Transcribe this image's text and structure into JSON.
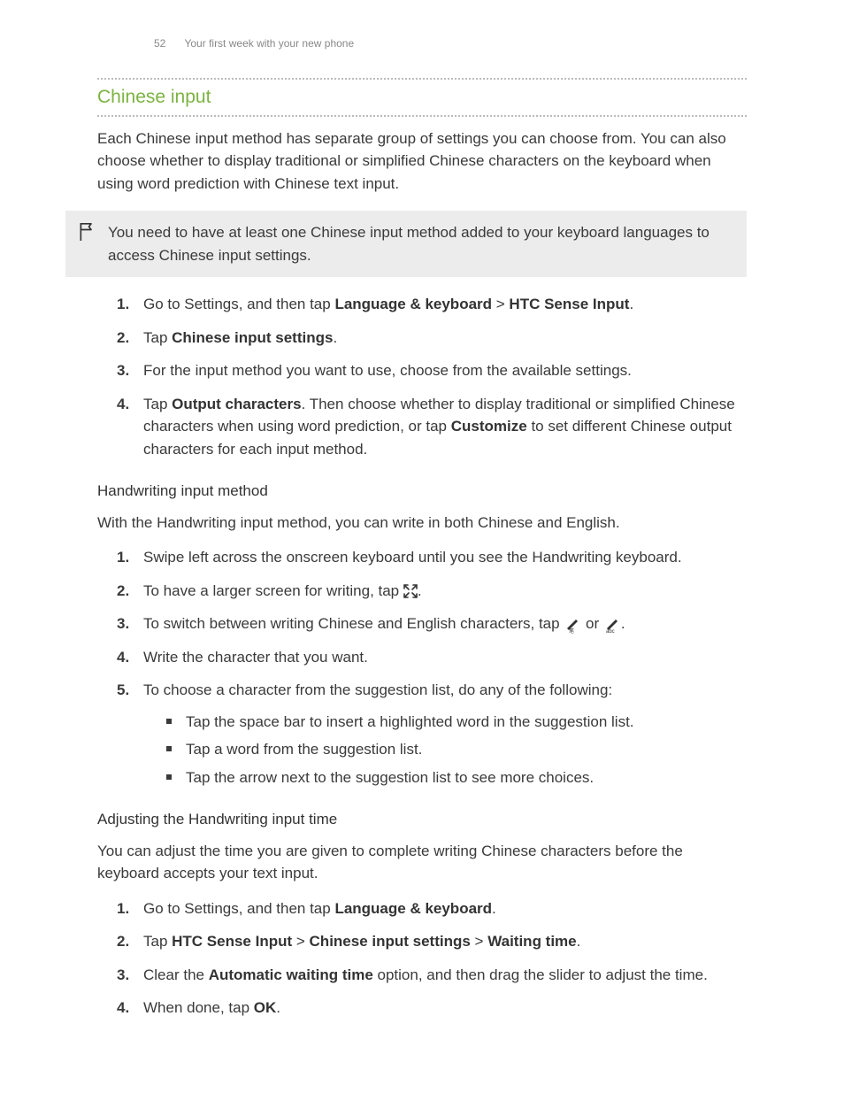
{
  "header": {
    "page_number": "52",
    "section": "Your first week with your new phone"
  },
  "title": "Chinese input",
  "intro": "Each Chinese input method has separate group of settings you can choose from. You can also choose whether to display traditional or simplified Chinese characters on the keyboard when using word prediction with Chinese text input.",
  "note": "You need to have at least one Chinese input method added to your keyboard languages to access Chinese input settings.",
  "steps_a": {
    "s1_pre": "Go to Settings, and then tap ",
    "s1_b1": "Language & keyboard",
    "s1_mid": " > ",
    "s1_b2": "HTC Sense Input",
    "s1_post": ".",
    "s2_pre": "Tap ",
    "s2_b1": "Chinese input settings",
    "s2_post": ".",
    "s3": "For the input method you want to use, choose from the available settings.",
    "s4_pre": "Tap ",
    "s4_b1": "Output characters",
    "s4_mid": ". Then choose whether to display traditional or simplified Chinese characters when using word prediction, or tap ",
    "s4_b2": "Customize",
    "s4_post": " to set different Chinese output characters for each input method."
  },
  "hand_heading": "Handwriting input method",
  "hand_intro": "With the Handwriting input method, you can write in both Chinese and English.",
  "steps_b": {
    "s1": "Swipe left across the onscreen keyboard until you see the Handwriting keyboard.",
    "s2_pre": "To have a larger screen for writing, tap ",
    "s2_post": ".",
    "s3_pre": "To switch between writing Chinese and English characters, tap ",
    "s3_or": " or ",
    "s3_post": ".",
    "s4": "Write the character that you want.",
    "s5": "To choose a character from the suggestion list, do any of the following:",
    "s5_bullets": {
      "b1": "Tap the space bar to insert a highlighted word in the suggestion list.",
      "b2": "Tap a word from the suggestion list.",
      "b3": "Tap the arrow next to the suggestion list to see more choices."
    }
  },
  "adj_heading": "Adjusting the Handwriting input time",
  "adj_intro": "You can adjust the time you are given to complete writing Chinese characters before the keyboard accepts your text input.",
  "steps_c": {
    "s1_pre": "Go to Settings, and then tap ",
    "s1_b1": "Language & keyboard",
    "s1_post": ".",
    "s2_pre": "Tap ",
    "s2_b1": "HTC Sense Input",
    "s2_m1": " > ",
    "s2_b2": "Chinese input settings",
    "s2_m2": " > ",
    "s2_b3": "Waiting time",
    "s2_post": ".",
    "s3_pre": "Clear the ",
    "s3_b1": "Automatic waiting time",
    "s3_post": " option, and then drag the slider to adjust the time.",
    "s4_pre": "When done, tap ",
    "s4_b1": "OK",
    "s4_post": "."
  }
}
